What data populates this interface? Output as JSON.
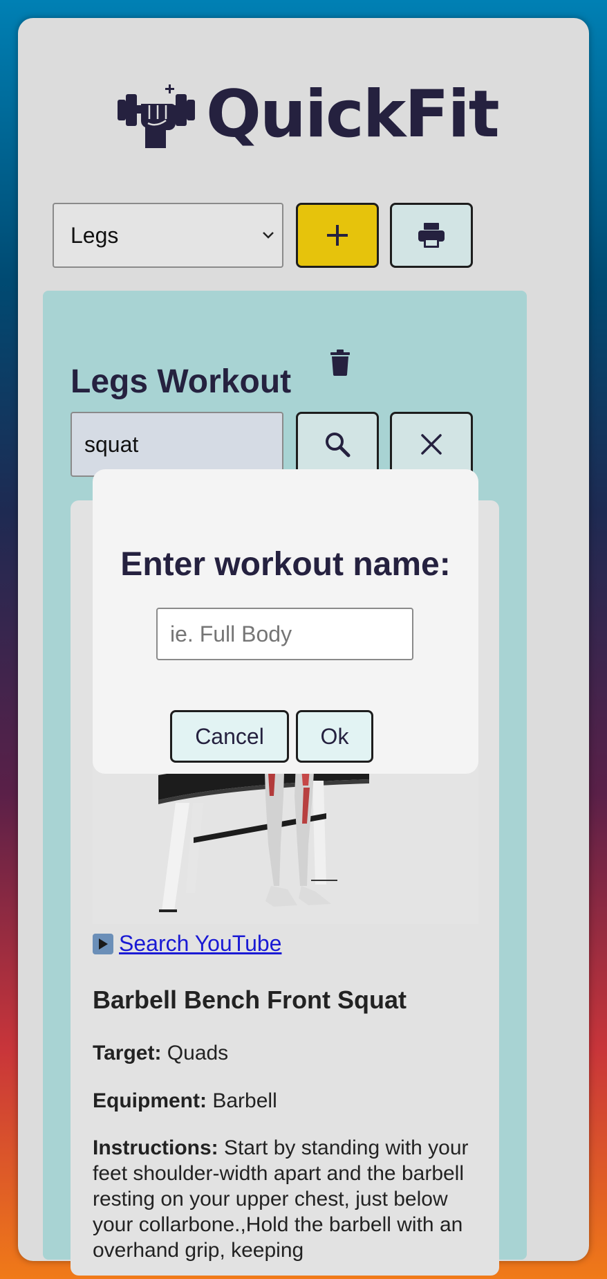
{
  "app": {
    "name": "QuickFit"
  },
  "toolbar": {
    "selected_workout": "Legs"
  },
  "workout": {
    "title": "Legs Workout"
  },
  "search": {
    "query": "squat"
  },
  "exercise": {
    "youtube_link": "Search YouTube",
    "name": "Barbell Bench Front Squat",
    "target_label": "Target:",
    "target_value": "Quads",
    "equipment_label": "Equipment:",
    "equipment_value": "Barbell",
    "instructions_label": "Instructions:",
    "instructions_text": "Start by standing with your feet shoulder-width apart and the barbell resting on your upper chest, just below your collarbone.,Hold the barbell with an overhand grip, keeping"
  },
  "modal": {
    "title": "Enter workout name:",
    "input_placeholder": "ie. Full Body",
    "cancel_label": "Cancel",
    "ok_label": "Ok"
  },
  "colors": {
    "brand": "#25213f",
    "add_button": "#e6c30c",
    "panel": "#a8d3d3",
    "link": "#1a1ad4"
  },
  "icons": [
    "dumbbell-fist-logo-icon",
    "chevron-down-icon",
    "plus-icon",
    "printer-icon",
    "trash-icon",
    "search-icon",
    "close-icon",
    "play-icon"
  ]
}
